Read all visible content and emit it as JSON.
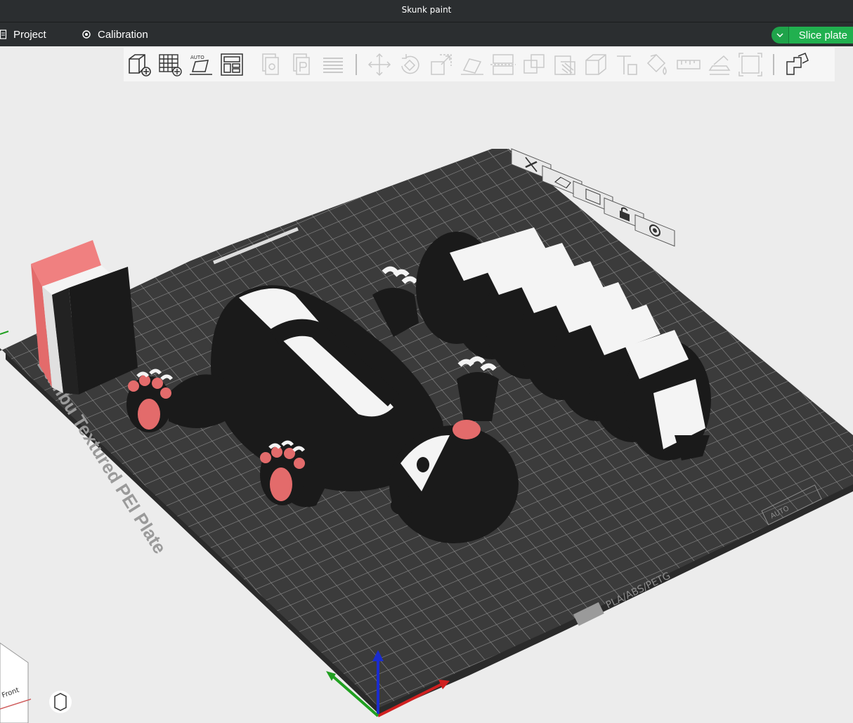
{
  "window": {
    "title": "Skunk paint"
  },
  "menu": {
    "project_label": "Project",
    "calibration_label": "Calibration",
    "slice_label": "Slice plate"
  },
  "toolbar": {
    "buttons": [
      "add-object-icon",
      "add-plate-icon",
      "auto-orient-icon",
      "arrange-icon",
      "copy-icon",
      "paste-icon",
      "layers-icon",
      "move-icon",
      "rotate-icon",
      "scale-icon",
      "lay-on-face-icon",
      "cut-icon",
      "boolean-icon",
      "support-paint-icon",
      "seam-paint-icon",
      "text-icon",
      "color-paint-icon",
      "measure-icon",
      "assembly-icon",
      "split-icon",
      "variable-layer-icon"
    ]
  },
  "plate": {
    "label": "Bambu Textured PEI Plate",
    "materials": "PLA/ABS/PETG",
    "corner_text": "AUTO",
    "bed_color": "#3b3b3b",
    "grid_color": "#8a8a8a"
  },
  "viewcube": {
    "front_label": "Front"
  },
  "colors": {
    "titlebar": "#2b2e30",
    "accent": "#21b04f",
    "filament_black": "#1a1a1a",
    "filament_white": "#f4f4f4",
    "filament_pink": "#e36b6b"
  }
}
